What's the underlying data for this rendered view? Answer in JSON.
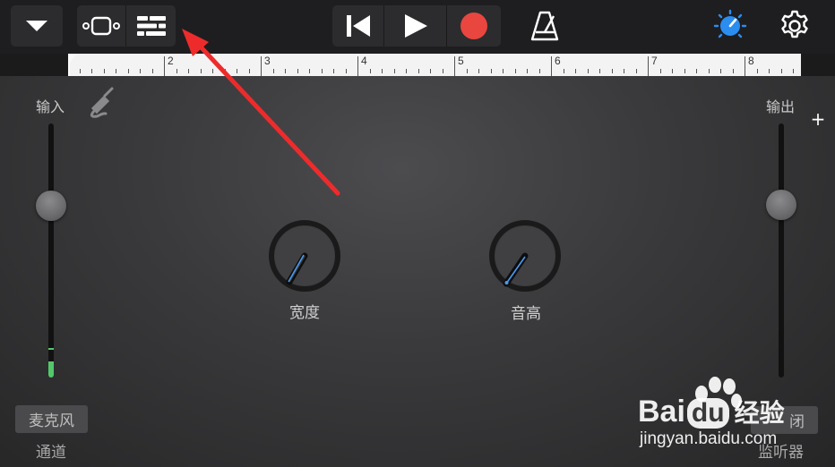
{
  "toolbar": {
    "icons": {
      "menu": "chevron-down-icon",
      "tracks_view": "tracks-view-icon",
      "mixer_view": "track-controls-icon",
      "rewind": "go-to-beginning-icon",
      "play": "play-icon",
      "record": "record-icon",
      "metronome": "metronome-icon",
      "master_effects": "knob-icon",
      "settings": "gear-icon"
    },
    "colors": {
      "record": "#e8463f",
      "master_effects": "#2c8df0"
    }
  },
  "ruler": {
    "bars": [
      "2",
      "3",
      "4",
      "5",
      "6",
      "7",
      "8"
    ],
    "add_label": "+"
  },
  "input": {
    "label": "输入",
    "icon": "instrument-jack-icon",
    "slider_level": 0.68,
    "meter_level": 0.06
  },
  "output": {
    "label": "输出",
    "slider_level": 0.68
  },
  "knobs": [
    {
      "label": "宽度",
      "value": 0.5
    },
    {
      "label": "音高",
      "value": 0.42
    }
  ],
  "bottom": {
    "mic_button": "麦克风",
    "channel_label": "通道",
    "monitor_label_partial": "闭",
    "monitor_label": "监听器"
  },
  "watermark": {
    "brand_a": "Bai",
    "brand_b": "du",
    "brand_c": "经验",
    "url": "jingyan.baidu.com"
  }
}
